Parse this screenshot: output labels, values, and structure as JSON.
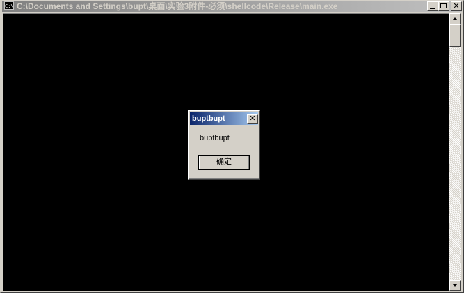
{
  "window": {
    "title": "C:\\Documents and Settings\\bupt\\桌面\\实验3附件-必须\\shellcode\\Release\\main.exe",
    "icon_text": "C:\\",
    "minimize_label": "_",
    "close_label": "✕"
  },
  "dialog": {
    "title": "buptbupt",
    "message": "buptbupt",
    "ok_label": "确定",
    "close_label": "✕"
  },
  "colors": {
    "console_bg": "#000000",
    "dialog_title_start": "#0a246a",
    "dialog_title_end": "#a6caf0",
    "window_face": "#d4d0c8"
  }
}
